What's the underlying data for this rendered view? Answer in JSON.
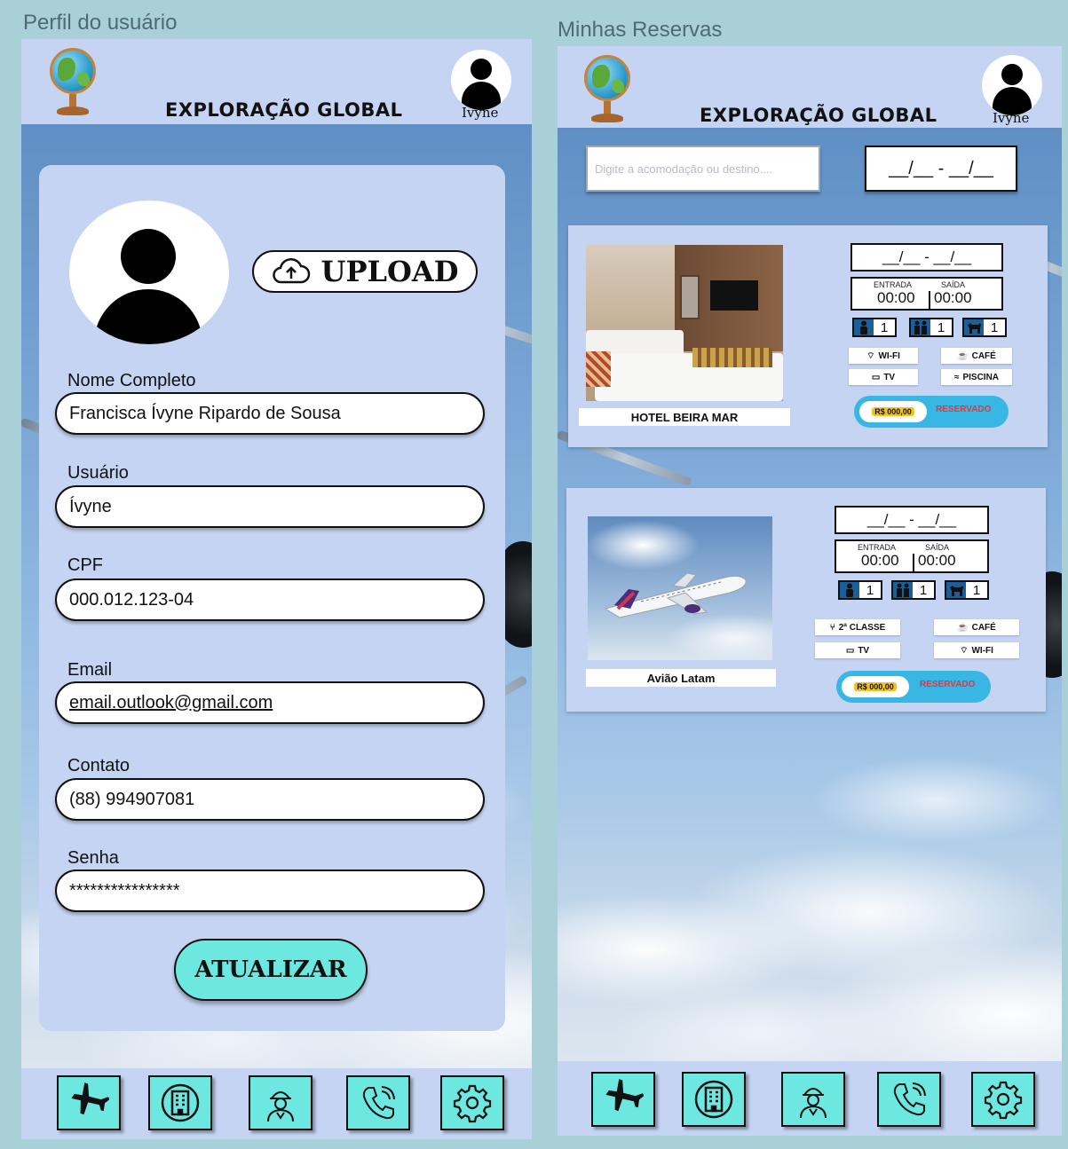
{
  "frames": {
    "profile_label": "Perfil do usuário",
    "reservations_label": "Minhas Reservas"
  },
  "header": {
    "brand": "EXPLORAÇÃO GLOBAL",
    "user_name": "Ivyne"
  },
  "profile": {
    "upload_label": "UPLOAD",
    "fields": {
      "full_name_label": "Nome Completo",
      "full_name_value": "Francisca Ívyne Ripardo de Sousa",
      "username_label": "Usuário",
      "username_value": "Ívyne",
      "cpf_label": "CPF",
      "cpf_value": "000.012.123-04",
      "email_label": "Email",
      "email_value": "email.outlook@gmail.com",
      "contact_label": "Contato",
      "contact_value": "(88) 994907081",
      "password_label": "Senha",
      "password_value": "****************"
    },
    "update_label": "ATUALIZAR"
  },
  "reservations": {
    "search_placeholder": "Digite a acomodação ou destino....",
    "date_range": "__/__ - __/__",
    "bookings": [
      {
        "name": "HOTEL BEIRA MAR",
        "date_range": "__/__ - __/__",
        "checkin_label": "ENTRADA",
        "checkin_time": "00:00",
        "checkout_label": "SAÍDA",
        "checkout_time": "00:00",
        "adults": "1",
        "couples": "1",
        "pets": "1",
        "amenities": [
          "WI-FI",
          "CAFÉ",
          "TV",
          "PISCINA"
        ],
        "price": "R$ 000,00",
        "status": "RESERVADO"
      },
      {
        "name": "Avião Latam",
        "date_range": "__/__ - __/__",
        "checkin_label": "ENTRADA",
        "checkin_time": "00:00",
        "checkout_label": "SAÍDA",
        "checkout_time": "00:00",
        "adults": "1",
        "couples": "1",
        "pets": "1",
        "amenities": [
          "2ª CLASSE",
          "CAFÉ",
          "TV",
          "WI-FI"
        ],
        "price": "R$ 000,00",
        "status": "RESERVADO"
      }
    ]
  },
  "nav": {
    "icons": [
      "airplane-icon",
      "hotel-icon",
      "tour-guide-icon",
      "phone-icon",
      "settings-icon"
    ]
  },
  "colors": {
    "panel": "#c4d4f2",
    "accent": "#6de8e0",
    "reserved": "#e0383e",
    "price_pill": "#39b7e4"
  }
}
